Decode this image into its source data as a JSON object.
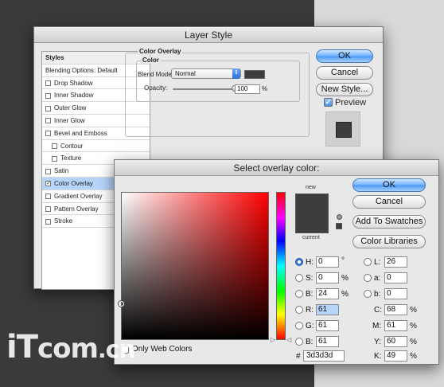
{
  "layer_style": {
    "title": "Layer Style",
    "list": {
      "header": "Styles",
      "items": [
        {
          "label": "Blending Options: Default",
          "checkbox": false,
          "checked": false,
          "indent": false,
          "selected": false
        },
        {
          "label": "Drop Shadow",
          "checkbox": true,
          "checked": false,
          "indent": false,
          "selected": false
        },
        {
          "label": "Inner Shadow",
          "checkbox": true,
          "checked": false,
          "indent": false,
          "selected": false
        },
        {
          "label": "Outer Glow",
          "checkbox": true,
          "checked": false,
          "indent": false,
          "selected": false
        },
        {
          "label": "Inner Glow",
          "checkbox": true,
          "checked": false,
          "indent": false,
          "selected": false
        },
        {
          "label": "Bevel and Emboss",
          "checkbox": true,
          "checked": false,
          "indent": false,
          "selected": false
        },
        {
          "label": "Contour",
          "checkbox": true,
          "checked": false,
          "indent": true,
          "selected": false
        },
        {
          "label": "Texture",
          "checkbox": true,
          "checked": false,
          "indent": true,
          "selected": false
        },
        {
          "label": "Satin",
          "checkbox": true,
          "checked": false,
          "indent": false,
          "selected": false
        },
        {
          "label": "Color Overlay",
          "checkbox": true,
          "checked": true,
          "indent": false,
          "selected": true
        },
        {
          "label": "Gradient Overlay",
          "checkbox": true,
          "checked": false,
          "indent": false,
          "selected": false
        },
        {
          "label": "Pattern Overlay",
          "checkbox": true,
          "checked": false,
          "indent": false,
          "selected": false
        },
        {
          "label": "Stroke",
          "checkbox": true,
          "checked": false,
          "indent": false,
          "selected": false
        }
      ]
    },
    "overlay": {
      "group_title": "Color Overlay",
      "sub_title": "Color",
      "blend_label": "Blend Mode:",
      "blend_value": "Normal",
      "opacity_label": "Opacity:",
      "opacity_value": "100",
      "opacity_unit": "%",
      "opacity_fraction": 1.0,
      "color": "#3d3d3d"
    },
    "buttons": {
      "ok": "OK",
      "cancel": "Cancel",
      "new_style": "New Style..."
    },
    "preview_label": "Preview",
    "preview_checked": true
  },
  "picker": {
    "title": "Select overlay color:",
    "new_label": "new",
    "current_label": "current",
    "new_color": "#3d3d3d",
    "current_color": "#3d3d3d",
    "buttons": {
      "ok": "OK",
      "cancel": "Cancel",
      "add_swatches": "Add To Swatches",
      "color_libraries": "Color Libraries"
    },
    "only_web_colors": "Only Web Colors",
    "hsb": [
      {
        "label": "H:",
        "value": "0",
        "unit": "°",
        "selected": true
      },
      {
        "label": "S:",
        "value": "0",
        "unit": "%",
        "selected": false
      },
      {
        "label": "B:",
        "value": "24",
        "unit": "%",
        "selected": false
      }
    ],
    "rgb": [
      {
        "label": "R:",
        "value": "61",
        "highlight": true
      },
      {
        "label": "G:",
        "value": "61",
        "highlight": false
      },
      {
        "label": "B:",
        "value": "61",
        "highlight": false
      }
    ],
    "lab": [
      {
        "label": "L:",
        "value": "26"
      },
      {
        "label": "a:",
        "value": "0"
      },
      {
        "label": "b:",
        "value": "0"
      }
    ],
    "cmyk": [
      {
        "label": "C:",
        "value": "68",
        "unit": "%"
      },
      {
        "label": "M:",
        "value": "61",
        "unit": "%"
      },
      {
        "label": "Y:",
        "value": "60",
        "unit": "%"
      },
      {
        "label": "K:",
        "value": "49",
        "unit": "%"
      }
    ],
    "hex_prefix": "#",
    "hex": "3d3d3d"
  },
  "watermark": {
    "main": "iT",
    "mid": "com",
    "dot": ".",
    "suffix": "cn"
  }
}
